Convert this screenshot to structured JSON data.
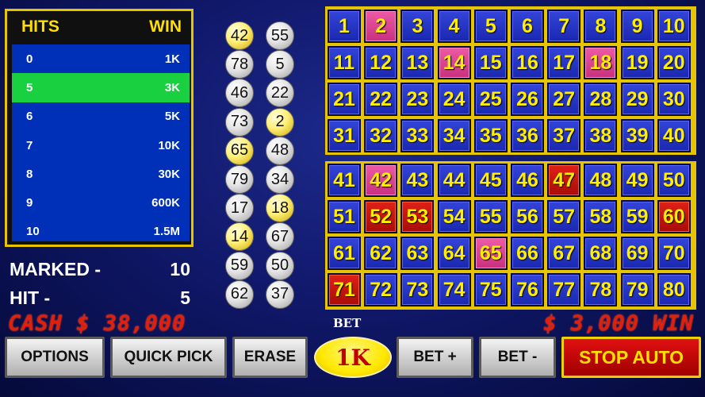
{
  "paytable": {
    "hits_header": "HITS",
    "win_header": "WIN",
    "rows": [
      {
        "hits": "0",
        "win": "1K"
      },
      {
        "hits": "5",
        "win": "3K"
      },
      {
        "hits": "6",
        "win": "5K"
      },
      {
        "hits": "7",
        "win": "10K"
      },
      {
        "hits": "8",
        "win": "30K"
      },
      {
        "hits": "9",
        "win": "600K"
      },
      {
        "hits": "10",
        "win": "1.5M"
      }
    ],
    "active_row": 1,
    "colors": {
      "border": "#e6c400",
      "body": "#0030b8",
      "active": "#18d040",
      "header": "#ffde00"
    }
  },
  "stats": {
    "marked_label": "MARKED -",
    "marked_value": "10",
    "hit_label": "HIT -",
    "hit_value": "5"
  },
  "cash": "CASH $ 38,000",
  "win": "$ 3,000 WIN",
  "drawn_balls": {
    "left": [
      "42",
      "78",
      "46",
      "73",
      "65",
      "79",
      "17",
      "14",
      "59",
      "62"
    ],
    "right": [
      "55",
      "5",
      "22",
      "2",
      "48",
      "34",
      "18",
      "67",
      "50",
      "37"
    ],
    "hits": [
      "42",
      "65",
      "14",
      "2",
      "18"
    ]
  },
  "board": {
    "marked": [
      2,
      14,
      18,
      42,
      65
    ],
    "hit": [
      47,
      52,
      53,
      60,
      71
    ],
    "colors": {
      "number": "#ffee00",
      "cell": "#2233c8",
      "marked": "#e0489a",
      "hit": "#d01810"
    }
  },
  "bet": {
    "label": "BET",
    "value": "1K"
  },
  "buttons": {
    "options": "OPTIONS",
    "quick_pick": "QUICK PICK",
    "erase": "ERASE",
    "bet_plus": "BET +",
    "bet_minus": "BET -",
    "stop_auto": "STOP AUTO"
  }
}
